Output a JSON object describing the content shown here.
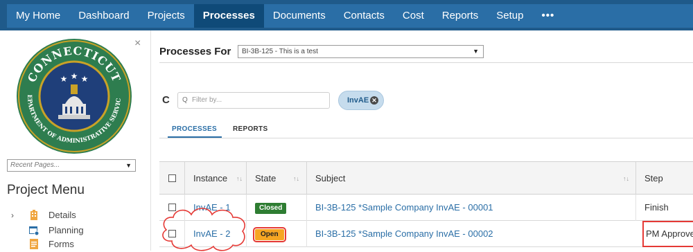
{
  "nav": {
    "items": [
      "My Home",
      "Dashboard",
      "Projects",
      "Processes",
      "Documents",
      "Contacts",
      "Cost",
      "Reports",
      "Setup"
    ],
    "active": "Processes",
    "more_label": "•••"
  },
  "left_panel": {
    "close_label": "×",
    "seal": {
      "top_text": "CONNECTICUT",
      "bottom_text": "DEPARTMENT OF ADMINISTRATIVE SERVICES",
      "colors": {
        "ring": "#2e7d4f",
        "center": "#1f3f7a",
        "gold": "#c9a227"
      }
    },
    "recent_pages_placeholder": "Recent Pages...",
    "project_menu_title": "Project Menu",
    "menu": [
      {
        "label": "Details",
        "icon": "building-icon",
        "has_chevron": true
      },
      {
        "label": "Planning",
        "icon": "calendar-icon",
        "has_chevron": false
      },
      {
        "label": "Forms",
        "icon": "form-icon",
        "has_chevron": false
      }
    ]
  },
  "main": {
    "processes_for_label": "Processes For",
    "project_select_value": "BI-3B-125 - This is a test",
    "filter_placeholder": "Filter by...",
    "filter_chip": "InvAE",
    "tabs": [
      "PROCESSES",
      "REPORTS"
    ],
    "active_tab": "PROCESSES",
    "table": {
      "headers": {
        "instance": "Instance",
        "state": "State",
        "subject": "Subject",
        "step": "Step"
      },
      "rows": [
        {
          "instance": "InvAE - 1",
          "state": "Closed",
          "subject": "BI-3B-125 *Sample Company InvAE - 00001",
          "step": "Finish"
        },
        {
          "instance": "InvAE - 2",
          "state": "Open",
          "subject": "BI-3B-125 *Sample Company InvAE - 00002",
          "step": "PM Approve"
        }
      ]
    }
  },
  "colors": {
    "nav_bg": "#2a6ea6",
    "nav_active": "#0f4a78",
    "link": "#2a6ea6",
    "closed_badge": "#2e7d32",
    "open_badge": "#f6a623",
    "annotation_red": "#e53935"
  }
}
